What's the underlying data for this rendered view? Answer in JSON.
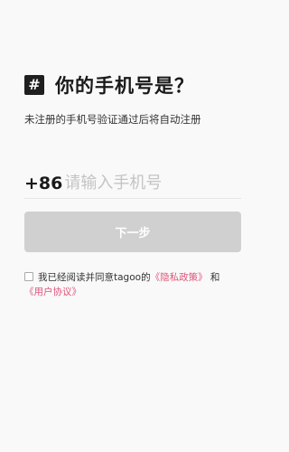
{
  "header": {
    "logo_glyph": "#",
    "title": "你的手机号是？",
    "subtitle": "未注册的手机号验证通过后将自动注册"
  },
  "phone": {
    "country_code": "+86",
    "placeholder": "请输入手机号",
    "value": ""
  },
  "actions": {
    "next_label": "下一步"
  },
  "agreement": {
    "checked": false,
    "prefix": "我已经阅读并同意tagoo的",
    "privacy_link": "《隐私政策》",
    "and": "和",
    "user_link": "《用户协议》"
  },
  "colors": {
    "background": "#f9f9f9",
    "button_disabled": "#d0d0d0",
    "link": "#e0567a"
  }
}
